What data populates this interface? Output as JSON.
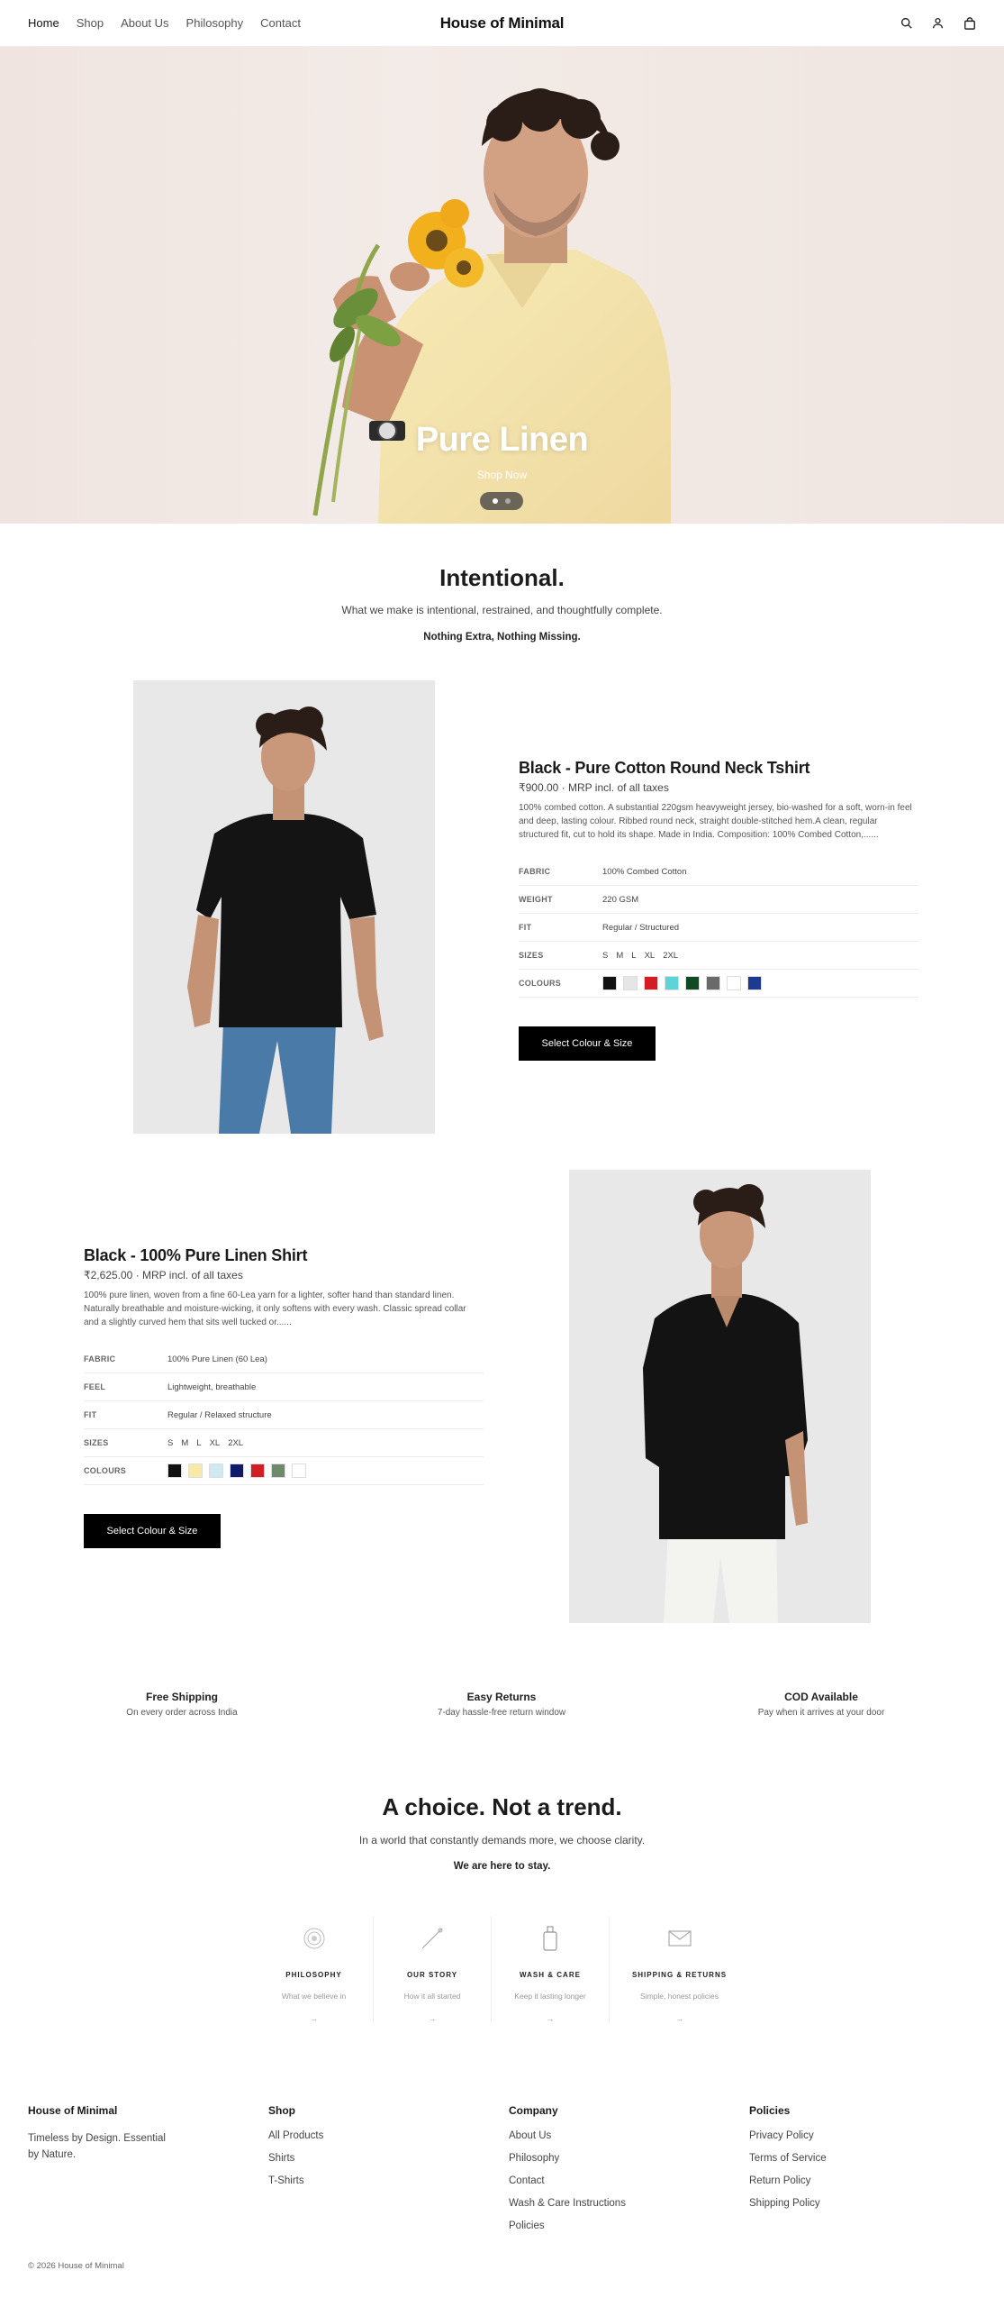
{
  "header": {
    "nav": [
      "Home",
      "Shop",
      "About Us",
      "Philosophy",
      "Contact"
    ],
    "logo": "House of Minimal",
    "icons": [
      "search-icon",
      "account-icon",
      "cart-icon"
    ]
  },
  "hero": {
    "title": "Pure Linen",
    "cta": "Shop Now",
    "slide_count": 2,
    "active_slide": 1
  },
  "intro": {
    "title": "Intentional.",
    "subtitle": "What we make is intentional, restrained, and thoughtfully complete.",
    "tagline": "Nothing Extra, Nothing Missing."
  },
  "product1": {
    "title": "Black - Pure Cotton Round Neck Tshirt",
    "price": "₹900.00 · MRP incl. of all taxes",
    "description": "100% combed cotton. A substantial 220gsm heavyweight jersey, bio-washed for a soft, worn-in feel and deep, lasting colour. Ribbed round neck, straight double-stitched hem.A clean, regular structured fit, cut to hold its shape. Made in India. Composition: 100% Combed Cotton,......",
    "specs": [
      {
        "key": "FABRIC",
        "value": "100% Combed Cotton"
      },
      {
        "key": "WEIGHT",
        "value": "220 GSM"
      },
      {
        "key": "FIT",
        "value": "Regular / Structured"
      }
    ],
    "sizes_label": "SIZES",
    "sizes": [
      "S",
      "M",
      "L",
      "XL",
      "2XL"
    ],
    "colours_label": "COLOURS",
    "colours": [
      "#111111",
      "#e6e6e6",
      "#d31e24",
      "#5dd5d8",
      "#0f4a24",
      "#6a6a6a",
      "#ffffff",
      "#1d3b8e"
    ],
    "button": "Select Colour & Size"
  },
  "product2": {
    "title": "Black - 100% Pure Linen Shirt",
    "price": "₹2,625.00 · MRP incl. of all taxes",
    "description": "100% pure linen, woven from a fine 60-Lea yarn for a lighter, softer hand than standard linen. Naturally breathable and moisture-wicking, it only softens with every wash. Classic spread collar and a slightly curved hem that sits well tucked or......",
    "specs": [
      {
        "key": "FABRIC",
        "value": "100% Pure Linen (60 Lea)"
      },
      {
        "key": "FEEL",
        "value": "Lightweight, breathable"
      },
      {
        "key": "FIT",
        "value": "Regular / Relaxed structure"
      }
    ],
    "sizes_label": "SIZES",
    "sizes": [
      "S",
      "M",
      "L",
      "XL",
      "2XL"
    ],
    "colours_label": "COLOURS",
    "colours": [
      "#111111",
      "#f7e9a8",
      "#cfe9f3",
      "#101a6a",
      "#d31e24",
      "#6f8a6a",
      "#ffffff"
    ],
    "button": "Select Colour & Size"
  },
  "features": [
    {
      "title": "Free Shipping",
      "text": "On every order across India"
    },
    {
      "title": "Easy Returns",
      "text": "7-day hassle-free return window"
    },
    {
      "title": "COD Available",
      "text": "Pay when it arrives at your door"
    }
  ],
  "choice": {
    "title": "A choice. Not a trend.",
    "subtitle": "In a world that constantly demands more, we choose clarity.",
    "tagline": "We are here to stay."
  },
  "cards": [
    {
      "title": "PHILOSOPHY",
      "text": "What we believe in",
      "arrow": "→",
      "icon": "target-icon"
    },
    {
      "title": "OUR STORY",
      "text": "How it all started",
      "arrow": "→",
      "icon": "needle-icon"
    },
    {
      "title": "WASH & CARE",
      "text": "Keep it lasting longer",
      "arrow": "→",
      "icon": "bottle-icon"
    },
    {
      "title": "SHIPPING & RETURNS",
      "text": "Simple, honest policies",
      "arrow": "→",
      "icon": "envelope-icon"
    }
  ],
  "footer": {
    "brand": "House of Minimal",
    "tagline": "Timeless by Design. Essential by Nature.",
    "shop": {
      "title": "Shop",
      "links": [
        "All Products",
        "Shirts",
        "T-Shirts"
      ]
    },
    "company": {
      "title": "Company",
      "links": [
        "About Us",
        "Philosophy",
        "Contact",
        "Wash & Care Instructions",
        "Policies"
      ]
    },
    "policies": {
      "title": "Policies",
      "links": [
        "Privacy Policy",
        "Terms of Service",
        "Return Policy",
        "Shipping Policy"
      ]
    },
    "copyright": "© 2026 House of Minimal"
  }
}
